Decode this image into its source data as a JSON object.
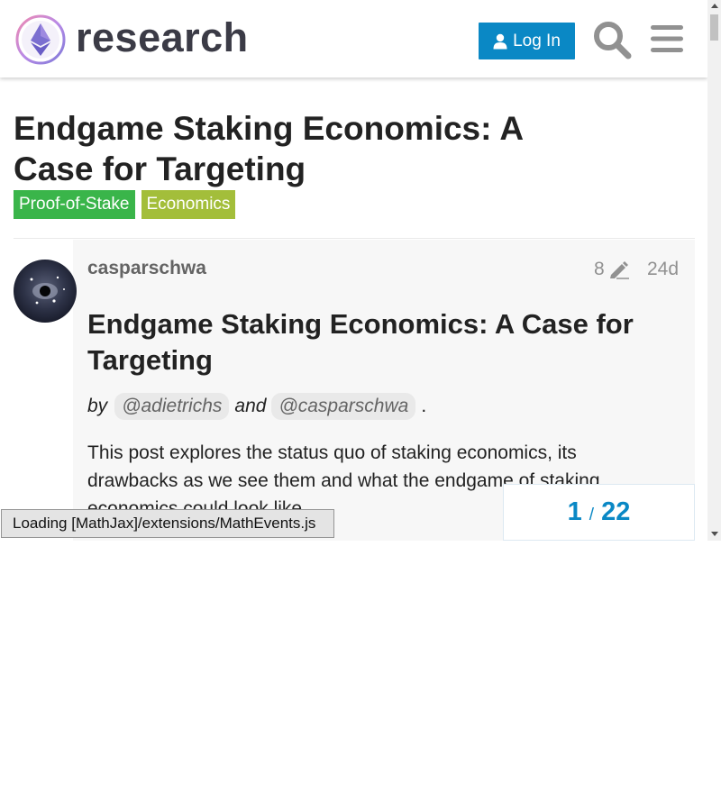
{
  "header": {
    "logo_text": "research",
    "login_label": "Log In"
  },
  "topic": {
    "title": "Endgame Staking Economics: A Case for Targeting",
    "categories": [
      {
        "label": "Proof-of-Stake",
        "color": "#3ab54a"
      },
      {
        "label": "Economics",
        "color": "#a3be3a"
      }
    ]
  },
  "post": {
    "username": "casparschwa",
    "edit_count": "8",
    "date": "24d",
    "heading": "Endgame Staking Economics: A Case for Targeting",
    "byline": {
      "prefix": "by",
      "mention_1": "@adietrichs",
      "conjunction": "and",
      "mention_2": "@casparschwa",
      "suffix": "."
    },
    "paragraph": "This post explores the status quo of staking economics, its drawbacks as we see them and what the endgame of staking economics could look like."
  },
  "progress": {
    "current": "1",
    "separator": "/",
    "total": "22"
  },
  "mathjax_message": "Loading [MathJax]/extensions/MathEvents.js",
  "colors": {
    "accent": "#0a88c5",
    "header_text": "#3b3b46"
  }
}
